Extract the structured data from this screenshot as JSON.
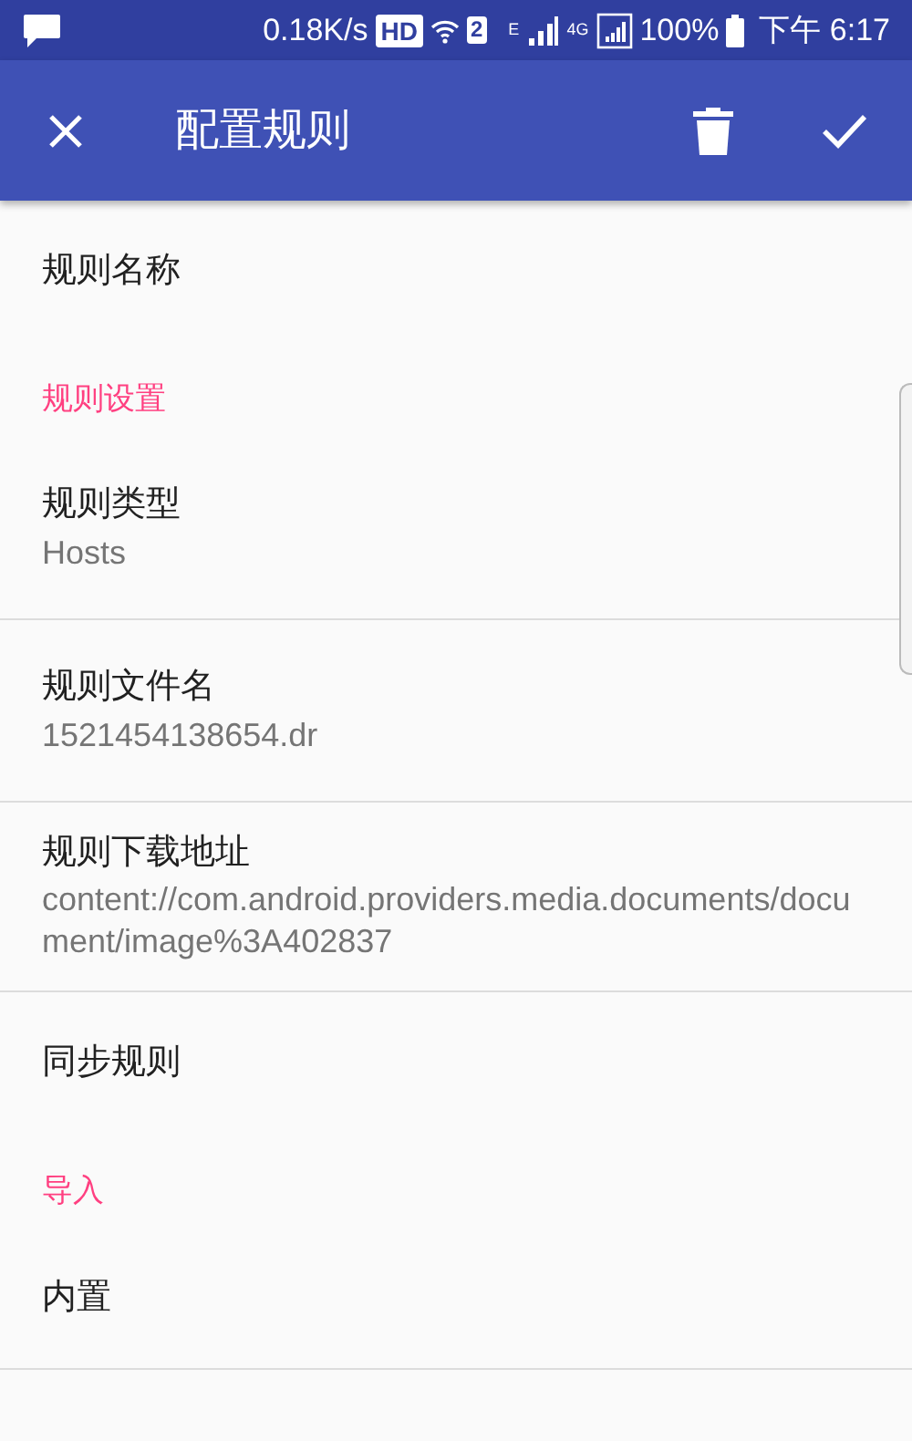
{
  "status_bar": {
    "speed": "0.18K/s",
    "hd": "HD",
    "sim": "2",
    "net_e": "E",
    "net_4g": "4G",
    "battery": "100%",
    "time": "下午 6:17"
  },
  "toolbar": {
    "title": "配置规则"
  },
  "items": [
    {
      "kind": "item",
      "title": "规则名称",
      "divider": false
    },
    {
      "kind": "header",
      "title": "规则设置"
    },
    {
      "kind": "item",
      "title": "规则类型",
      "summary": "Hosts",
      "divider": true
    },
    {
      "kind": "item",
      "title": "规则文件名",
      "summary": "1521454138654.dr",
      "divider": true
    },
    {
      "kind": "item",
      "title": "规则下载地址",
      "summary": "content://com.android.providers.media.documents/document/image%3A402837",
      "divider": true
    },
    {
      "kind": "item",
      "title": "同步规则",
      "divider": false
    },
    {
      "kind": "header",
      "title": "导入"
    },
    {
      "kind": "item",
      "title": "内置",
      "divider": true
    }
  ]
}
